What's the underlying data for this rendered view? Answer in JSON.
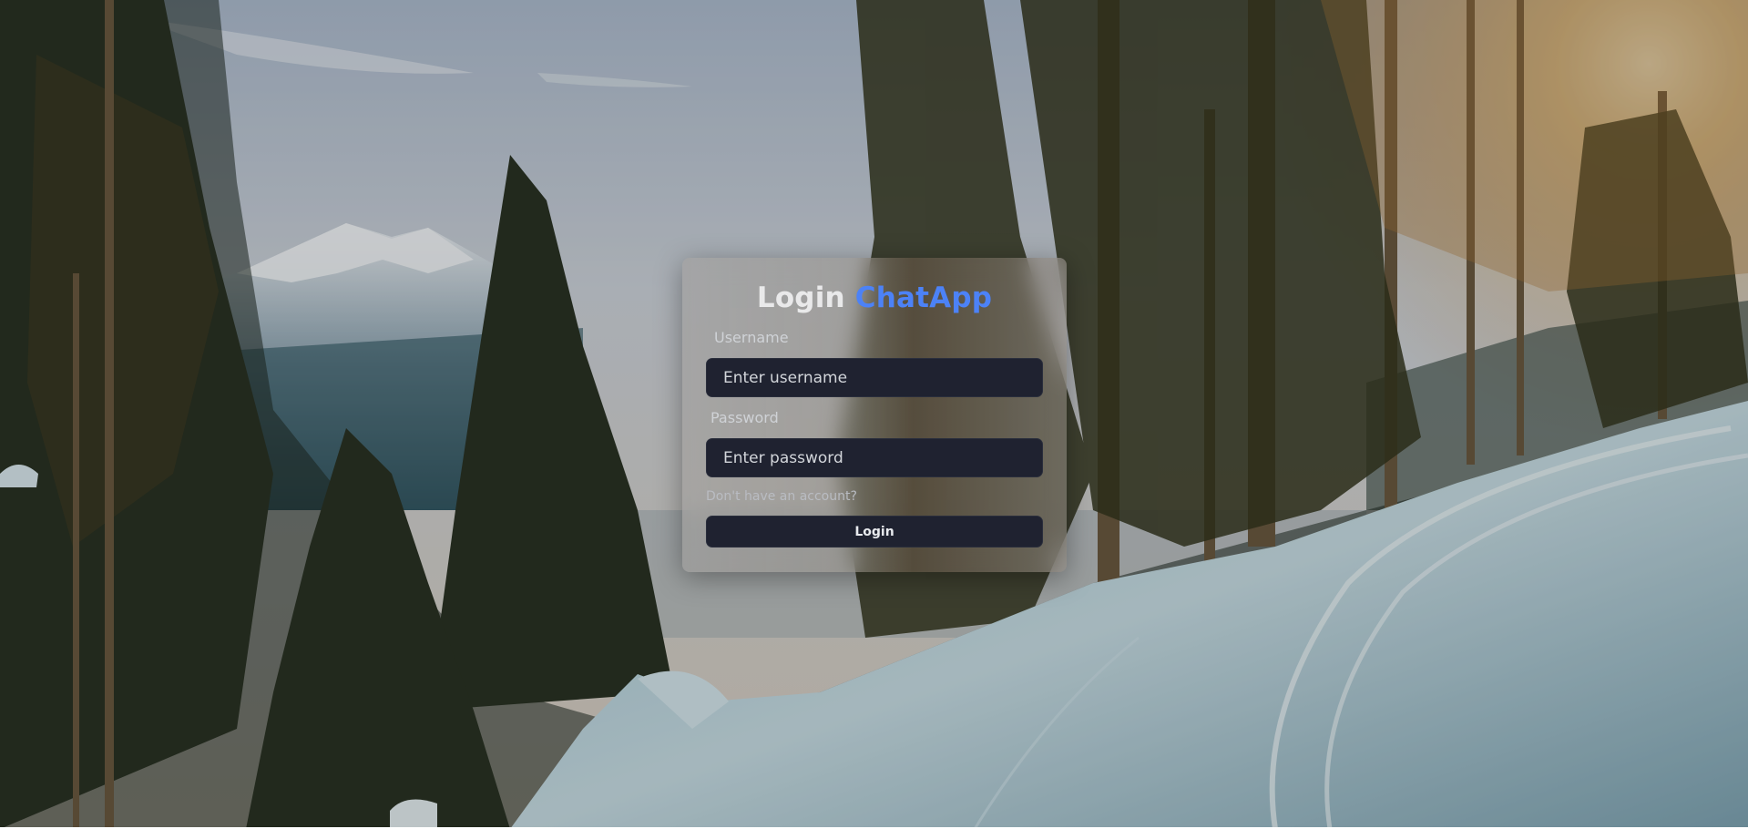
{
  "page": {
    "title_part1": "Login",
    "title_part2": "ChatApp",
    "accent_color": "#4c82f7"
  },
  "form": {
    "username_label": "Username",
    "username_placeholder": "Enter username",
    "username_value": "",
    "password_label": "Password",
    "password_placeholder": "Enter password",
    "password_value": "",
    "signup_prompt": "Don't have an account?",
    "submit_label": "Login"
  },
  "background": {
    "scene": "snowy mountain forest path at sunset"
  }
}
